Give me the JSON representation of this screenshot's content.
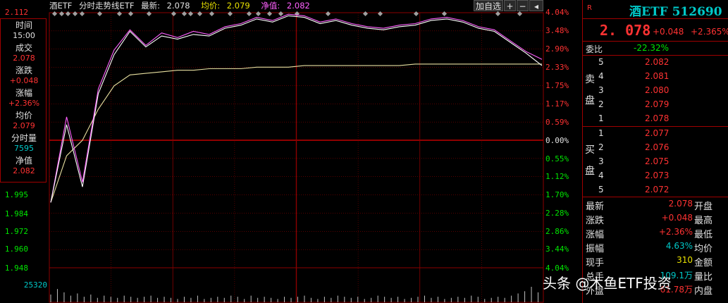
{
  "header": {
    "name": "酒ETF",
    "chart_title": "分时走势线ETF",
    "latest_label": "最新:",
    "latest_value": "2.078",
    "avg_label": "均价:",
    "avg_value": "2.079",
    "nav_label": "净值:",
    "nav_value": "2.082",
    "add_watch": "加自选",
    "plus": "+",
    "minus": "−",
    "arrow": "◂"
  },
  "info": {
    "items": [
      {
        "label": "时间",
        "value": "15:00",
        "color": "white"
      },
      {
        "label": "成交",
        "value": "2.078",
        "color": "red"
      },
      {
        "label": "涨跌",
        "value": "+0.048",
        "color": "red"
      },
      {
        "label": "涨幅",
        "value": "+2.36%",
        "color": "red"
      },
      {
        "label": "均价",
        "value": "2.079",
        "color": "red"
      },
      {
        "label": "分时量",
        "value": "7595",
        "color": "cyan"
      },
      {
        "label": "净值",
        "value": "2.082",
        "color": "red"
      }
    ]
  },
  "price_axis": {
    "top": "2.112",
    "lower": [
      "1.995",
      "1.984",
      "1.972",
      "1.960",
      "1.948"
    ],
    "volume": "25320"
  },
  "pct_axis": {
    "positive": [
      "4.04%",
      "3.48%",
      "2.90%",
      "2.33%",
      "1.75%",
      "1.17%",
      "0.59%"
    ],
    "zero": "0.00%",
    "negative": [
      "0.55%",
      "1.12%",
      "1.70%",
      "2.28%",
      "2.86%",
      "3.44%",
      "4.04%"
    ]
  },
  "right": {
    "r_mark": "R",
    "title": "酒ETF 512690",
    "price": "2. 078",
    "change": "+0.048",
    "change_pct": "+2.365%",
    "weibi_label": "委比",
    "weibi_value": "-22.32%",
    "sell_label": "卖盘",
    "buy_label": "买盘",
    "sells": [
      {
        "level": "5",
        "price": "2.082"
      },
      {
        "level": "4",
        "price": "2.081"
      },
      {
        "level": "3",
        "price": "2.080"
      },
      {
        "level": "2",
        "price": "2.079"
      },
      {
        "level": "1",
        "price": "2.078"
      }
    ],
    "buys": [
      {
        "level": "1",
        "price": "2.077"
      },
      {
        "level": "2",
        "price": "2.076"
      },
      {
        "level": "3",
        "price": "2.075"
      },
      {
        "level": "4",
        "price": "2.073"
      },
      {
        "level": "5",
        "price": "2.072"
      }
    ],
    "stats": [
      {
        "label": "最新",
        "value": "2.078",
        "color": "red",
        "label2": "开盘"
      },
      {
        "label": "涨跌",
        "value": "+0.048",
        "color": "red",
        "label2": "最高"
      },
      {
        "label": "涨幅",
        "value": "+2.36%",
        "color": "red",
        "label2": "最低"
      },
      {
        "label": "振幅",
        "value": "4.63%",
        "color": "cyan",
        "label2": "均价"
      },
      {
        "label": "现手",
        "value": "310",
        "color": "yellow",
        "label2": "金额"
      },
      {
        "label": "总手",
        "value": "109.1万",
        "color": "cyan",
        "label2": "量比"
      },
      {
        "label": "外盘",
        "value": "61.78万",
        "color": "red",
        "label2": "内盘"
      }
    ]
  },
  "watermark": "头条 @木鱼ETF投资",
  "colors": {
    "price_line": "#ffffff",
    "nav_line": "#ff60ff",
    "avg_line": "#e8e0a0",
    "grid_red": "#8b0000",
    "volume_bar": "#c0c0c0"
  },
  "chart_data": {
    "type": "line",
    "title": "分时走势线ETF",
    "session": "intraday",
    "prev_close": 2.03,
    "ylim": [
      1.948,
      2.112
    ],
    "pct_range": [
      -4.04,
      4.04
    ],
    "series": [
      {
        "name": "最新",
        "values": [
          1.99,
          2.04,
          2.0,
          2.06,
          2.085,
          2.1,
          2.09,
          2.097,
          2.095,
          2.098,
          2.097,
          2.102,
          2.104,
          2.108,
          2.106,
          2.11,
          2.109,
          2.105,
          2.107,
          2.104,
          2.102,
          2.101,
          2.103,
          2.104,
          2.107,
          2.108,
          2.106,
          2.102,
          2.1,
          2.093,
          2.086,
          2.078
        ]
      },
      {
        "name": "净值",
        "values": [
          1.99,
          2.045,
          2.003,
          2.063,
          2.088,
          2.101,
          2.091,
          2.099,
          2.096,
          2.1,
          2.098,
          2.103,
          2.105,
          2.109,
          2.107,
          2.111,
          2.11,
          2.106,
          2.108,
          2.105,
          2.103,
          2.102,
          2.104,
          2.105,
          2.108,
          2.109,
          2.107,
          2.103,
          2.101,
          2.094,
          2.087,
          2.082
        ]
      },
      {
        "name": "均价",
        "values": [
          1.99,
          2.02,
          2.03,
          2.05,
          2.065,
          2.072,
          2.073,
          2.074,
          2.075,
          2.075,
          2.076,
          2.076,
          2.076,
          2.077,
          2.077,
          2.077,
          2.078,
          2.078,
          2.078,
          2.078,
          2.078,
          2.078,
          2.078,
          2.079,
          2.079,
          2.079,
          2.079,
          2.079,
          2.079,
          2.079,
          2.079,
          2.079
        ]
      }
    ],
    "volume": [
      7,
      12,
      9,
      6,
      8,
      5,
      7,
      4,
      6,
      5,
      4,
      6,
      5,
      4,
      5,
      6,
      4,
      5,
      4,
      3,
      5,
      4,
      6,
      3,
      4,
      5,
      4,
      6,
      5,
      3,
      6,
      4,
      5,
      4,
      3,
      5,
      4,
      5,
      6,
      4,
      3,
      5,
      4,
      6,
      5,
      4,
      5,
      3,
      4,
      6,
      5,
      4,
      5,
      3,
      4,
      5,
      6,
      4,
      5,
      3,
      4,
      5,
      4,
      6,
      5,
      3,
      4,
      5,
      4,
      6,
      8,
      10,
      14,
      9
    ],
    "volume_max": 25320
  }
}
